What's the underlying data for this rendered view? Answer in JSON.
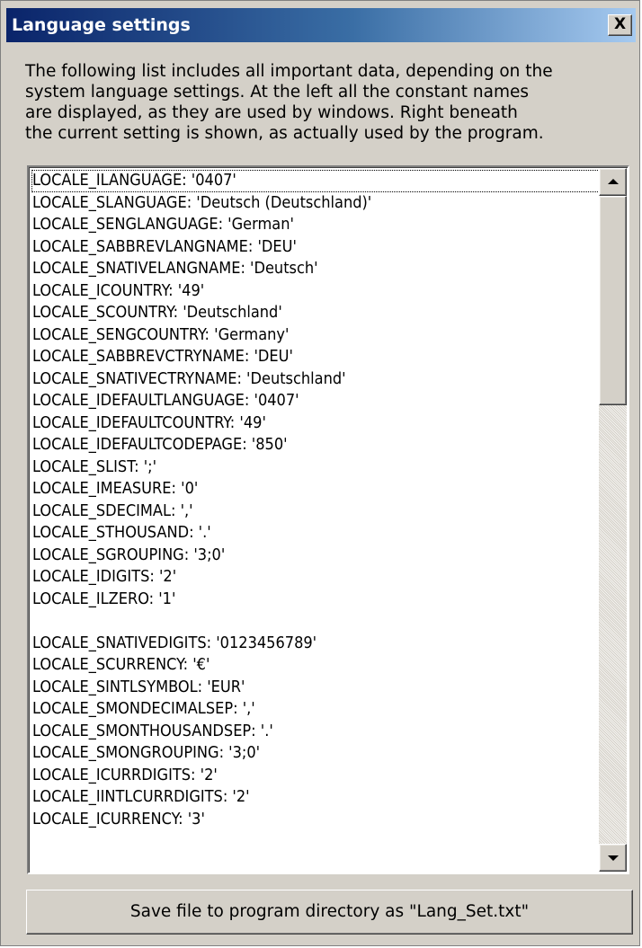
{
  "window": {
    "title": "Language settings",
    "close_symbol": "X"
  },
  "description": "The following list includes all important data, depending on the\nsystem language settings. At the left all the constant names\nare displayed,  as they are used by windows. Right beneath\nthe current setting is shown, as actually used by the program.",
  "list": {
    "items": [
      "LOCALE_ILANGUAGE: '0407'",
      "LOCALE_SLANGUAGE: 'Deutsch (Deutschland)'",
      "LOCALE_SENGLANGUAGE: 'German'",
      "LOCALE_SABBREVLANGNAME: 'DEU'",
      "LOCALE_SNATIVELANGNAME: 'Deutsch'",
      "LOCALE_ICOUNTRY: '49'",
      "LOCALE_SCOUNTRY: 'Deutschland'",
      "LOCALE_SENGCOUNTRY: 'Germany'",
      "LOCALE_SABBREVCTRYNAME: 'DEU'",
      "LOCALE_SNATIVECTRYNAME: 'Deutschland'",
      "LOCALE_IDEFAULTLANGUAGE: '0407'",
      "LOCALE_IDEFAULTCOUNTRY: '49'",
      "LOCALE_IDEFAULTCODEPAGE: '850'",
      "LOCALE_SLIST: ';'",
      "LOCALE_IMEASURE: '0'",
      "LOCALE_SDECIMAL: ','",
      "LOCALE_STHOUSAND: '.'",
      "LOCALE_SGROUPING: '3;0'",
      "LOCALE_IDIGITS: '2'",
      "LOCALE_ILZERO: '1'",
      "",
      "LOCALE_SNATIVEDIGITS: '0123456789'",
      "LOCALE_SCURRENCY: '€'",
      "LOCALE_SINTLSYMBOL: 'EUR'",
      "LOCALE_SMONDECIMALSEP: ','",
      "LOCALE_SMONTHOUSANDSEP: '.'",
      "LOCALE_SMONGROUPING: '3;0'",
      "LOCALE_ICURRDIGITS: '2'",
      "LOCALE_IINTLCURRDIGITS: '2'",
      "LOCALE_ICURRENCY: '3'"
    ],
    "selected_index": 0
  },
  "save_button_label": "Save file to program directory as \"Lang_Set.txt\""
}
